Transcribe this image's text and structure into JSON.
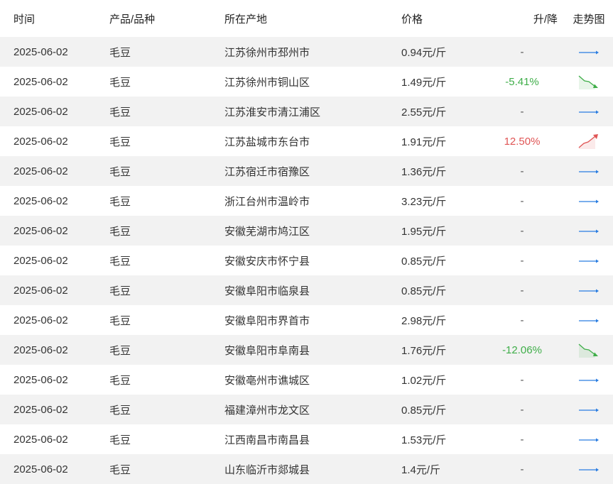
{
  "header": {
    "date": "时间",
    "product": "产品/品种",
    "location": "所在产地",
    "price": "价格",
    "change": "升/降",
    "trend": "走势图"
  },
  "rows": [
    {
      "date": "2025-06-02",
      "product": "毛豆",
      "location": "江苏徐州市邳州市",
      "price": "0.94元/斤",
      "change": "-",
      "trend": "flat"
    },
    {
      "date": "2025-06-02",
      "product": "毛豆",
      "location": "江苏徐州市铜山区",
      "price": "1.49元/斤",
      "change": "-5.41%",
      "trend": "down"
    },
    {
      "date": "2025-06-02",
      "product": "毛豆",
      "location": "江苏淮安市清江浦区",
      "price": "2.55元/斤",
      "change": "-",
      "trend": "flat"
    },
    {
      "date": "2025-06-02",
      "product": "毛豆",
      "location": "江苏盐城市东台市",
      "price": "1.91元/斤",
      "change": "12.50%",
      "trend": "up"
    },
    {
      "date": "2025-06-02",
      "product": "毛豆",
      "location": "江苏宿迁市宿豫区",
      "price": "1.36元/斤",
      "change": "-",
      "trend": "flat"
    },
    {
      "date": "2025-06-02",
      "product": "毛豆",
      "location": "浙江台州市温岭市",
      "price": "3.23元/斤",
      "change": "-",
      "trend": "flat"
    },
    {
      "date": "2025-06-02",
      "product": "毛豆",
      "location": "安徽芜湖市鸠江区",
      "price": "1.95元/斤",
      "change": "-",
      "trend": "flat"
    },
    {
      "date": "2025-06-02",
      "product": "毛豆",
      "location": "安徽安庆市怀宁县",
      "price": "0.85元/斤",
      "change": "-",
      "trend": "flat"
    },
    {
      "date": "2025-06-02",
      "product": "毛豆",
      "location": "安徽阜阳市临泉县",
      "price": "0.85元/斤",
      "change": "-",
      "trend": "flat"
    },
    {
      "date": "2025-06-02",
      "product": "毛豆",
      "location": "安徽阜阳市界首市",
      "price": "2.98元/斤",
      "change": "-",
      "trend": "flat"
    },
    {
      "date": "2025-06-02",
      "product": "毛豆",
      "location": "安徽阜阳市阜南县",
      "price": "1.76元/斤",
      "change": "-12.06%",
      "trend": "down"
    },
    {
      "date": "2025-06-02",
      "product": "毛豆",
      "location": "安徽亳州市谯城区",
      "price": "1.02元/斤",
      "change": "-",
      "trend": "flat"
    },
    {
      "date": "2025-06-02",
      "product": "毛豆",
      "location": "福建漳州市龙文区",
      "price": "0.85元/斤",
      "change": "-",
      "trend": "flat"
    },
    {
      "date": "2025-06-02",
      "product": "毛豆",
      "location": "江西南昌市南昌县",
      "price": "1.53元/斤",
      "change": "-",
      "trend": "flat"
    },
    {
      "date": "2025-06-02",
      "product": "毛豆",
      "location": "山东临沂市郯城县",
      "price": "1.4元/斤",
      "change": "-",
      "trend": "flat"
    }
  ],
  "colors": {
    "up": "#e05555",
    "down": "#3fae49",
    "flat": "#2a7de1"
  }
}
